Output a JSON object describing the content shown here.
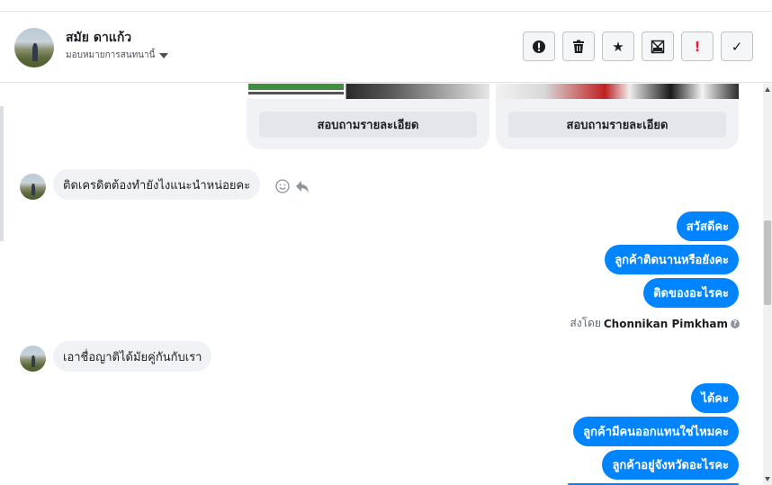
{
  "header": {
    "contact_name": "สมัย ดาแก้ว",
    "assignee_label": "มอบหมายการสนทนานี้",
    "actions": [
      {
        "name": "spam-button",
        "icon": "alert-circle-icon",
        "glyph": "⬤"
      },
      {
        "name": "delete-button",
        "icon": "trash-icon",
        "glyph": ""
      },
      {
        "name": "star-button",
        "icon": "star-icon",
        "glyph": "★"
      },
      {
        "name": "archive-button",
        "icon": "archive-icon",
        "glyph": "⊠"
      },
      {
        "name": "important-button",
        "icon": "exclamation-icon",
        "glyph": "!"
      },
      {
        "name": "done-button",
        "icon": "check-icon",
        "glyph": "✓"
      }
    ]
  },
  "cards": [
    {
      "button_label": "สอบถามรายละเอียด"
    },
    {
      "button_label": "สอบถามรายละเอียด"
    }
  ],
  "messages": {
    "incoming_1": "ติดเครดิตต้องทำยังไงแนะนำหน่อยคะ",
    "outgoing_1": [
      "สวัสดีคะ",
      "ลูกค้าติดนานหรือยังคะ",
      "ติดของอะไรคะ"
    ],
    "sent_by_prefix": "ส่งโดย",
    "sent_by_name": "Chonnikan Pimkham",
    "incoming_2": "เอาชื่อญาติได้มัยคู่กันกับเรา",
    "outgoing_2": [
      "ได้คะ",
      "ลูกค้ามีคนออกแทนใช่ไหมคะ",
      "ลูกค้าอยู่จังหวัดอะไรคะ"
    ]
  },
  "colors": {
    "outgoing_bubble": "#0084ff",
    "incoming_bubble": "#f0f2f5",
    "important_red": "#e41e3f"
  }
}
